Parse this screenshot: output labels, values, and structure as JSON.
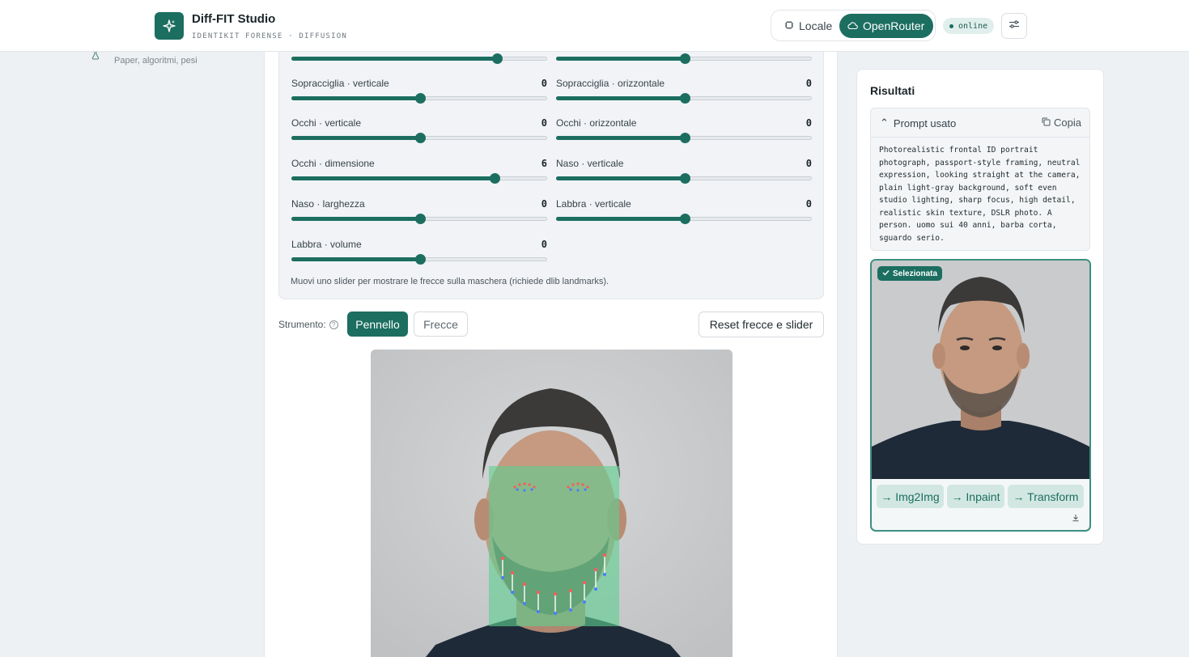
{
  "header": {
    "title": "Diff-FIT Studio",
    "subtitle": "IDENTIKIT FORENSE · DIFFUSION",
    "logo_icon": "sparkles-icon",
    "modes": [
      {
        "label": "Locale",
        "icon": "chip-icon",
        "active": false
      },
      {
        "label": "OpenRouter",
        "icon": "cloud-icon",
        "active": true
      }
    ],
    "status": "online",
    "settings_icon": "sliders-icon"
  },
  "nav": {
    "item_subtitle": "Paper, algoritmi, pesi",
    "item_icon": "flask-icon"
  },
  "sliders": [
    {
      "label": "",
      "value": "",
      "level": 0.8
    },
    {
      "label": "",
      "value": "",
      "level": 0.5
    },
    {
      "label": "Sopracciglia · verticale",
      "value": "0",
      "level": 0.5
    },
    {
      "label": "Sopracciglia · orizzontale",
      "value": "0",
      "level": 0.5
    },
    {
      "label": "Occhi · verticale",
      "value": "0",
      "level": 0.5
    },
    {
      "label": "Occhi · orizzontale",
      "value": "0",
      "level": 0.5
    },
    {
      "label": "Occhi · dimensione",
      "value": "6",
      "level": 0.79
    },
    {
      "label": "Naso · verticale",
      "value": "0",
      "level": 0.5
    },
    {
      "label": "Naso · larghezza",
      "value": "0",
      "level": 0.5
    },
    {
      "label": "Labbra · verticale",
      "value": "0",
      "level": 0.5
    },
    {
      "label": "Labbra · volume",
      "value": "0",
      "level": 0.5
    }
  ],
  "sliders_hint": "Muovi uno slider per mostrare le frecce sulla maschera (richiede dlib landmarks).",
  "toolbar": {
    "tool_label": "Strumento:",
    "help_glyph": "?",
    "brush_label": "Pennello",
    "arrows_label": "Frecce",
    "reset_label": "Reset frecce e slider"
  },
  "results": {
    "title": "Risultati",
    "prompt_header": "Prompt usato",
    "collapse_glyph": "⌃",
    "copy_label": "Copia",
    "prompt_text": "Photorealistic frontal ID portrait photograph, passport-style framing, neutral expression, looking straight at the camera, plain light-gray background, soft even studio lighting, sharp focus, high detail, realistic skin texture, DSLR photo. A person. uomo sui 40 anni, barba corta, sguardo serio.",
    "selected_badge": "Selezionata",
    "actions": [
      "→ Img2Img",
      "→ Inpaint",
      "→ Transform"
    ],
    "download_icon": "download-icon"
  },
  "colors": {
    "accent": "#1c6e60",
    "accent_light": "#d2e7e2",
    "mask": "#5fcf8f"
  }
}
